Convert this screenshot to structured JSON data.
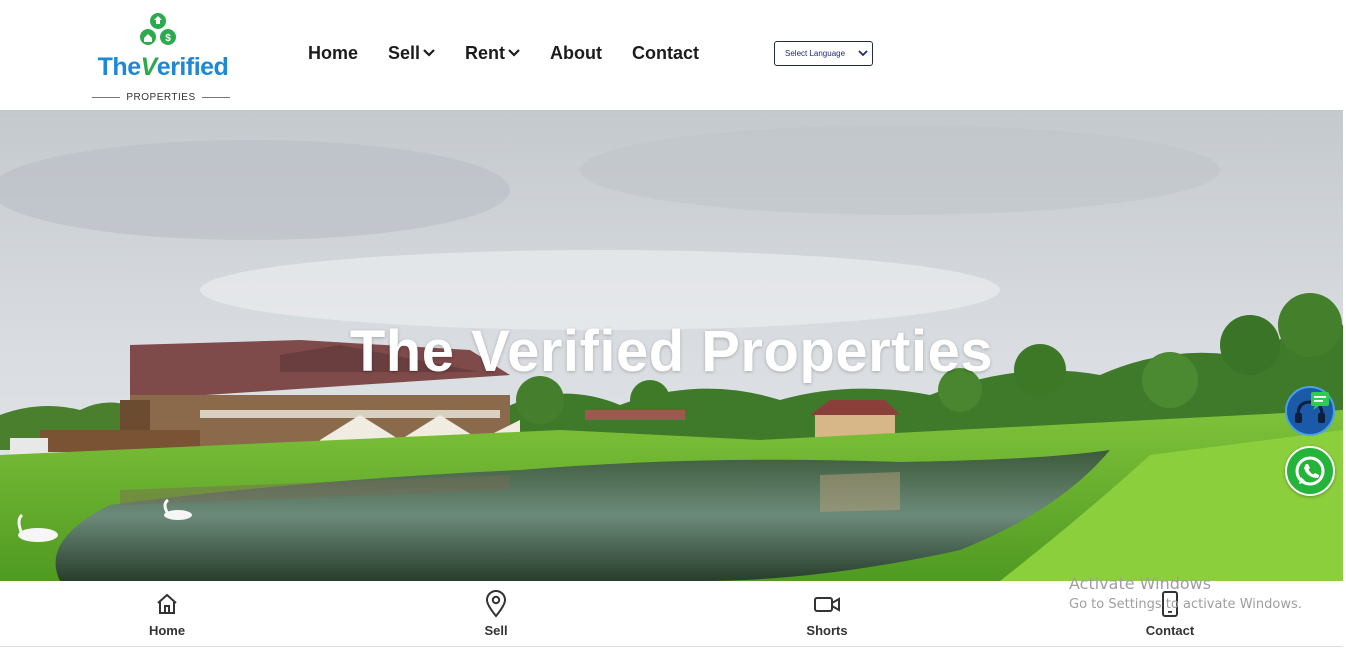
{
  "brand": {
    "logo_word_prefix": "The",
    "logo_word_v": "V",
    "logo_word_suffix": "erified",
    "logo_subtitle": "PROPERTIES",
    "colors": {
      "blue": "#1e88d6",
      "green": "#2eaa4e"
    }
  },
  "nav": {
    "items": [
      {
        "label": "Home",
        "has_dropdown": false
      },
      {
        "label": "Sell",
        "has_dropdown": true
      },
      {
        "label": "Rent",
        "has_dropdown": true
      },
      {
        "label": "About",
        "has_dropdown": false
      },
      {
        "label": "Contact",
        "has_dropdown": false
      }
    ]
  },
  "language_select": {
    "selected": "Select Language"
  },
  "hero": {
    "title": "The Verified Properties",
    "image": "lakeside-lodge-landscape"
  },
  "floating": {
    "support_icon": "headset-chat-icon",
    "whatsapp_icon": "whatsapp-icon"
  },
  "bottom_nav": {
    "items": [
      {
        "label": "Home",
        "icon": "home-icon"
      },
      {
        "label": "Sell",
        "icon": "map-pin-icon"
      },
      {
        "label": "Shorts",
        "icon": "video-camera-icon"
      },
      {
        "label": "Contact",
        "icon": "phone-icon"
      }
    ]
  },
  "os_watermark": {
    "line1": "Activate Windows",
    "line2": "Go to Settings to activate Windows."
  }
}
